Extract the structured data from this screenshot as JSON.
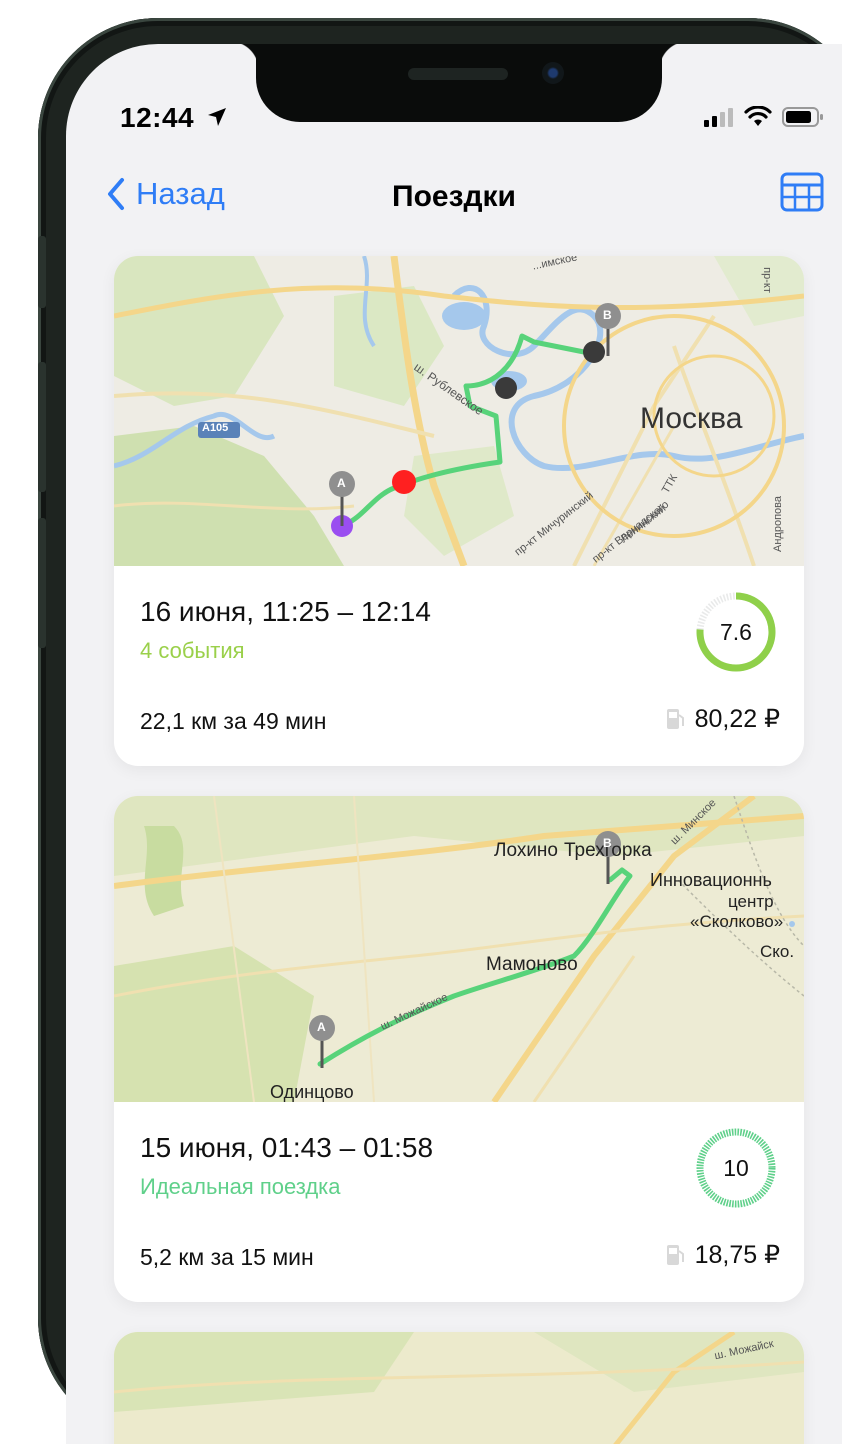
{
  "status_bar": {
    "time": "12:44"
  },
  "nav": {
    "back_label": "Назад",
    "title": "Поездки",
    "action_icon": "table-icon"
  },
  "trips": [
    {
      "date_range": "16 июня, 11:25 – 12:14",
      "events": "4 события",
      "events_color": "#9ad04a",
      "score": "7.6",
      "score_fraction": 0.76,
      "distance": "22,1 км за 49 мин",
      "fuel_cost": "80,22 ₽",
      "map_labels": {
        "city": "Москва",
        "road_a105": "A105",
        "road_rublevskoe": "ш. Рублевское",
        "road_michurinsky": "пр-кт Мичуринский",
        "road_vernadskogo": "пр-кт Вернадского",
        "road_leninsky": "Ленинский",
        "ttk": "ТТК",
        "pin_a": "A",
        "pin_b": "B",
        "top_label": "...имское",
        "right_top": "пр-кт",
        "right_edge": "Андропова"
      }
    },
    {
      "date_range": "15 июня, 01:43 – 01:58",
      "events": "Идеальная поездка",
      "events_color": "#5fd08a",
      "score": "10",
      "score_fraction": 1.0,
      "distance": "5,2 км за 15 мин",
      "fuel_cost": "18,75 ₽",
      "map_labels": {
        "place1": "Лохино",
        "place2": "Трехгорка",
        "innov1": "Инновационнь",
        "innov2": "центр",
        "innov3": "«Сколково»",
        "sko": "Ско.",
        "mamonovo": "Мамоново",
        "odintsovo": "Одинцово",
        "road_minskoe": "ш. Минское",
        "road_mozhaiskoe": "ш. Можайское",
        "pin_a": "A",
        "pin_b": "B"
      }
    },
    {
      "map_labels": {
        "road_mozhaiskoe": "ш. Можайск"
      }
    }
  ],
  "colors": {
    "accent": "#2f7df6",
    "route": "#58d37a",
    "score_ring_good": "#5fd08a",
    "score_ring_mid": "#9ad04a"
  }
}
